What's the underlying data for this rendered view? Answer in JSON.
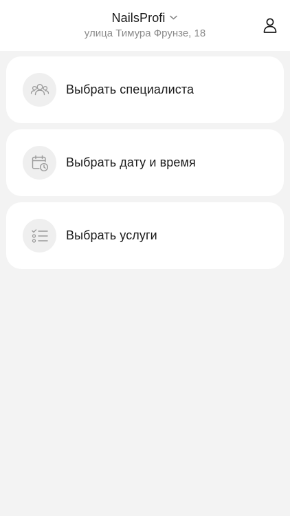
{
  "header": {
    "title": "NailsProfi",
    "address": "улица Тимура Фрунзе, 18",
    "icons": {
      "dropdown": "chevron-down-icon",
      "profile": "user-icon"
    }
  },
  "menu": {
    "items": [
      {
        "label": "Выбрать специалиста",
        "icon": "users-icon"
      },
      {
        "label": "Выбрать дату и время",
        "icon": "calendar-clock-icon"
      },
      {
        "label": "Выбрать услуги",
        "icon": "checklist-icon"
      }
    ]
  },
  "colors": {
    "background": "#f3f3f3",
    "card": "#ffffff",
    "icon_circle": "#efefef",
    "icon_stroke": "#9a9a9a",
    "text": "#1a1a1a",
    "subtext": "#8a8a8a"
  }
}
